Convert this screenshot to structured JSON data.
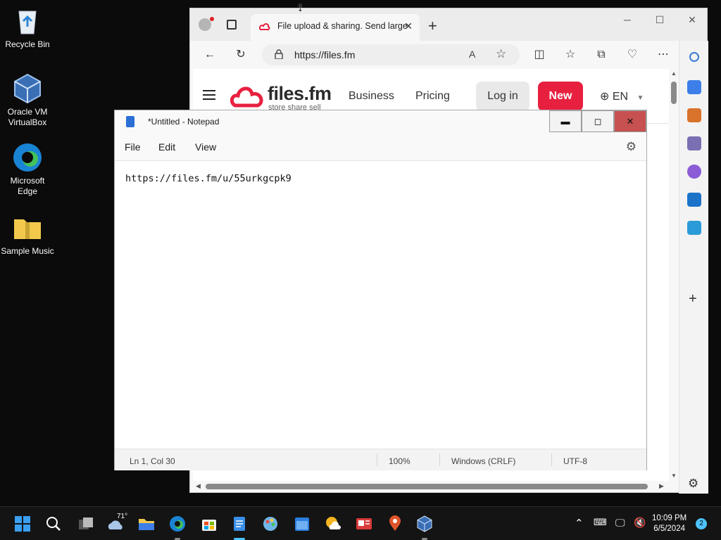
{
  "desktop": {
    "icons": [
      {
        "label": "Recycle Bin",
        "icon": "recycle-bin-icon"
      },
      {
        "label": "Oracle VM VirtualBox",
        "icon": "virtualbox-icon"
      },
      {
        "label": "Microsoft Edge",
        "icon": "edge-icon"
      },
      {
        "label": "Sample Music",
        "icon": "zip-folder-icon"
      }
    ]
  },
  "edge": {
    "tab_title": "File upload & sharing. Send large",
    "address": "https://files.fm",
    "site": {
      "brand": "files.fm",
      "tagline": "store share sell",
      "nav": [
        "Business",
        "Pricing"
      ],
      "login": "Log in",
      "new": "New",
      "lang": "EN"
    }
  },
  "notepad": {
    "title": "*Untitled - Notepad",
    "menu": [
      "File",
      "Edit",
      "View"
    ],
    "content": "https://files.fm/u/55urkgcpk9",
    "status": {
      "position": "Ln 1, Col 30",
      "zoom": "100%",
      "line_ending": "Windows (CRLF)",
      "encoding": "UTF-8"
    }
  },
  "taskbar": {
    "weather": "71°",
    "time": "10:09 PM",
    "date": "6/5/2024",
    "notification_count": "2"
  },
  "colors": {
    "brand_red": "#e8203f",
    "close_red": "#c75050",
    "accent_blue": "#2b6fd6"
  }
}
